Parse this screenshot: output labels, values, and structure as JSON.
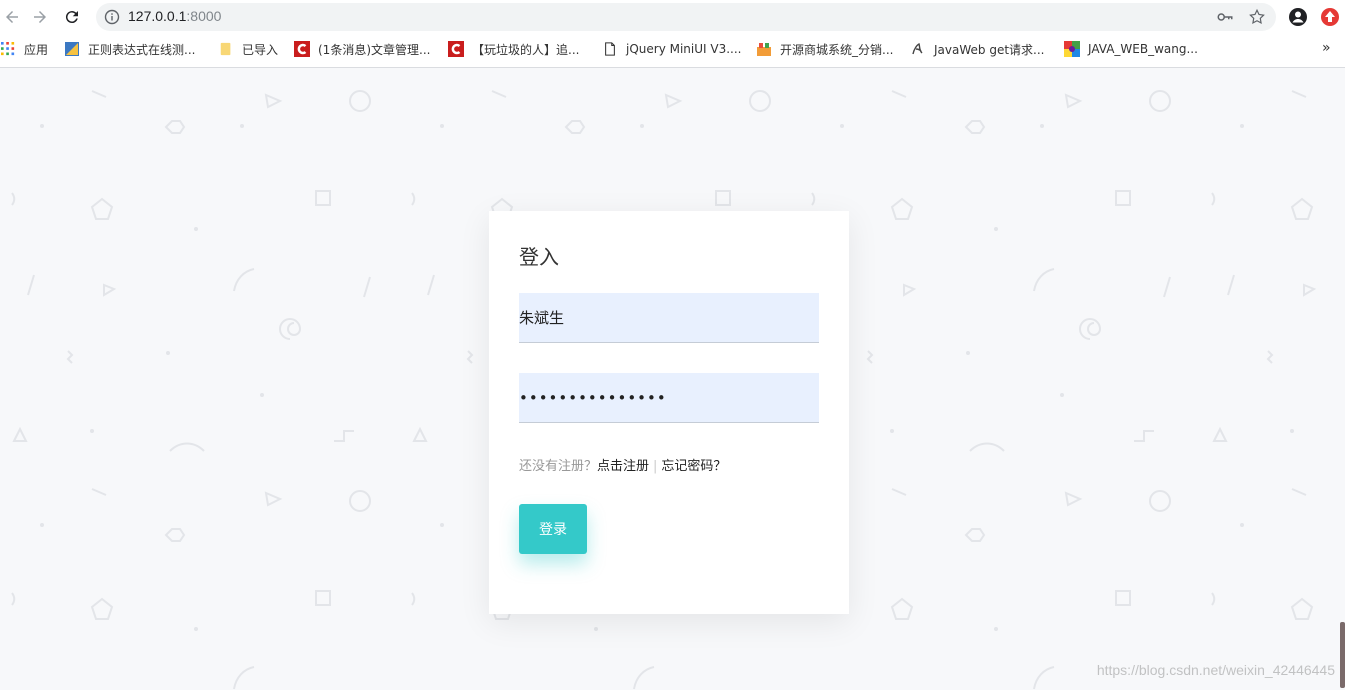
{
  "browser": {
    "url_host": "127.0.0.1",
    "url_port": ":8000",
    "icons": {
      "back": "back-arrow-icon",
      "forward": "forward-arrow-icon",
      "reload": "reload-icon",
      "info": "info-icon",
      "key": "key-icon",
      "star": "star-icon",
      "profile": "profile-icon",
      "extension": "extension-icon"
    },
    "bookmarks": [
      {
        "label": "应用",
        "icon": "apps-grid-icon"
      },
      {
        "label": "正则表达式在线测...",
        "icon": "regex-site-icon"
      },
      {
        "label": "已导入",
        "icon": "folder-icon"
      },
      {
        "label": "(1条消息)文章管理...",
        "icon": "csdn-icon"
      },
      {
        "label": "【玩垃圾的人】追...",
        "icon": "csdn-icon"
      },
      {
        "label": "jQuery MiniUI V3....",
        "icon": "page-icon"
      },
      {
        "label": "开源商城系统_分销...",
        "icon": "shop-icon"
      },
      {
        "label": "JavaWeb get请求...",
        "icon": "javaweb-icon"
      },
      {
        "label": "JAVA_WEB_wang...",
        "icon": "colorful-site-icon"
      }
    ],
    "bookmarks_more": "»"
  },
  "login": {
    "title": "登入",
    "username_value": "朱斌生",
    "password_value": "•••••••••••••••",
    "register_prompt": "还没有注册？",
    "register_link": "点击注册",
    "separator": "|",
    "forgot_link": "忘记密码？",
    "submit_label": "登录"
  },
  "colors": {
    "accent": "#34c9c9",
    "input_bg": "#e8f0fe",
    "page_bg": "#f7f8fa"
  },
  "watermark": "https://blog.csdn.net/weixin_42446445"
}
